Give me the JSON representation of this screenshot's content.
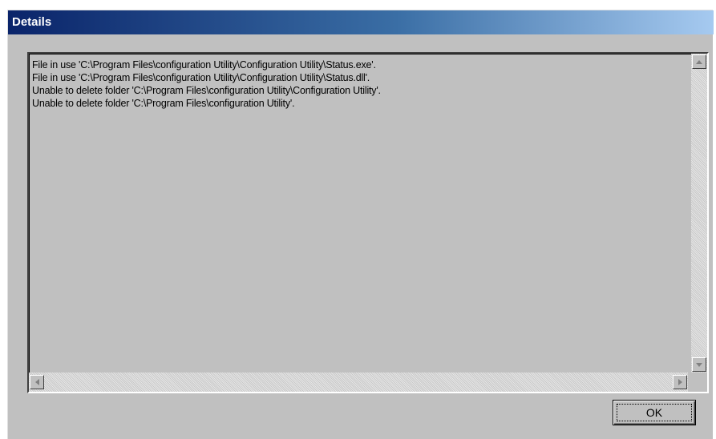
{
  "window": {
    "title": "Details"
  },
  "details": {
    "lines": [
      "File in use 'C:\\Program Files\\configuration Utility\\Configuration Utility\\Status.exe'.",
      "File in use 'C:\\Program Files\\configuration Utility\\Configuration Utility\\Status.dll'.",
      "Unable to delete folder 'C:\\Program Files\\configuration Utility\\Configuration Utility'.",
      "Unable to delete folder 'C:\\Program Files\\configuration Utility'."
    ]
  },
  "buttons": {
    "ok_label": "OK"
  },
  "icons": {
    "scroll_up": "arrow-up-icon",
    "scroll_down": "arrow-down-icon",
    "scroll_left": "arrow-left-icon",
    "scroll_right": "arrow-right-icon"
  },
  "colors": {
    "titlebar_start": "#0a246a",
    "titlebar_end": "#a6caf0",
    "face": "#c0c0c0"
  }
}
